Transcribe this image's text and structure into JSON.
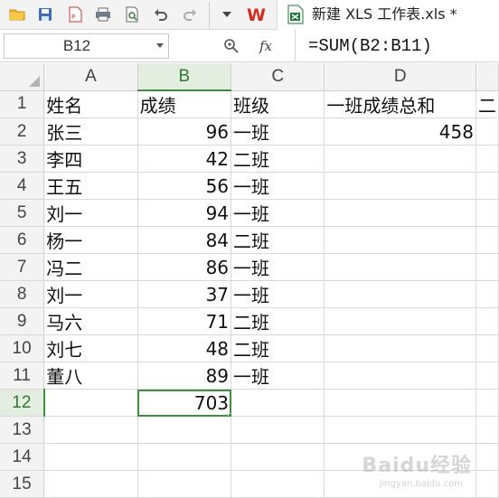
{
  "toolbar": {
    "icons": [
      "open-folder-icon",
      "save-icon",
      "export-pdf-icon",
      "print-icon",
      "print-preview-icon",
      "undo-icon",
      "redo-icon",
      "dropdown-icon"
    ],
    "app_logo": "W",
    "tab_title": "新建 XLS 工作表.xls *"
  },
  "formula_bar": {
    "name_box": "B12",
    "fx_label": "fx",
    "formula": "=SUM(B2:B11)"
  },
  "sheet": {
    "columns": [
      "A",
      "B",
      "C",
      "D",
      ""
    ],
    "selected_column": "B",
    "selected_row": "12",
    "rows": [
      {
        "n": "1",
        "a": "姓名",
        "b": "成绩",
        "c": "班级",
        "d": "一班成绩总和",
        "e": "二"
      },
      {
        "n": "2",
        "a": "张三",
        "b": "96",
        "c": "一班",
        "d": "458",
        "e": ""
      },
      {
        "n": "3",
        "a": "李四",
        "b": "42",
        "c": "二班",
        "d": "",
        "e": ""
      },
      {
        "n": "4",
        "a": "王五",
        "b": "56",
        "c": "一班",
        "d": "",
        "e": ""
      },
      {
        "n": "5",
        "a": "刘一",
        "b": "94",
        "c": "一班",
        "d": "",
        "e": ""
      },
      {
        "n": "6",
        "a": "杨一",
        "b": "84",
        "c": "二班",
        "d": "",
        "e": ""
      },
      {
        "n": "7",
        "a": "冯二",
        "b": "86",
        "c": "一班",
        "d": "",
        "e": ""
      },
      {
        "n": "8",
        "a": "刘一",
        "b": "37",
        "c": "一班",
        "d": "",
        "e": ""
      },
      {
        "n": "9",
        "a": "马六",
        "b": "71",
        "c": "二班",
        "d": "",
        "e": ""
      },
      {
        "n": "10",
        "a": "刘七",
        "b": "48",
        "c": "二班",
        "d": "",
        "e": ""
      },
      {
        "n": "11",
        "a": "董八",
        "b": "89",
        "c": "一班",
        "d": "",
        "e": ""
      },
      {
        "n": "12",
        "a": "",
        "b": "703",
        "c": "",
        "d": "",
        "e": ""
      },
      {
        "n": "13",
        "a": "",
        "b": "",
        "c": "",
        "d": "",
        "e": ""
      },
      {
        "n": "14",
        "a": "",
        "b": "",
        "c": "",
        "d": "",
        "e": ""
      },
      {
        "n": "15",
        "a": "",
        "b": "",
        "c": "",
        "d": "",
        "e": ""
      }
    ]
  },
  "watermark": {
    "text": "Baidu经验",
    "sub": "jingyan.baidu.com"
  },
  "colors": {
    "accent": "#3c8f3c",
    "wps_red": "#d42b1e",
    "excel_green": "#1f7a3a"
  }
}
